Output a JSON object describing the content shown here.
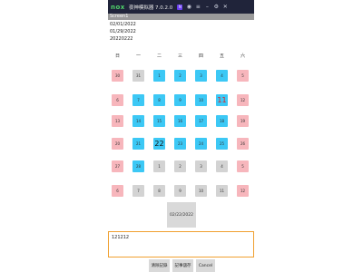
{
  "window": {
    "logo": "nox",
    "title": "夜神模拟器 7.0.2.0",
    "toolbar_icons": [
      "app-icon",
      "user-icon",
      "menu-icon",
      "minimize-icon",
      "settings-icon",
      "close-icon"
    ]
  },
  "screen": {
    "name": "Screen1"
  },
  "dates": [
    "02/01/2022",
    "01/29/2022",
    "20220222"
  ],
  "weekdays": [
    "日",
    "一",
    "二",
    "三",
    "四",
    "五",
    "六"
  ],
  "calendar": [
    [
      {
        "d": "30",
        "c": "pink"
      },
      {
        "d": "31",
        "c": "gray"
      },
      {
        "d": "1",
        "c": "blue"
      },
      {
        "d": "2",
        "c": "blue"
      },
      {
        "d": "3",
        "c": "blue"
      },
      {
        "d": "4",
        "c": "blue"
      },
      {
        "d": "5",
        "c": "pink"
      }
    ],
    [
      {
        "d": "6",
        "c": "pink"
      },
      {
        "d": "7",
        "c": "blue"
      },
      {
        "d": "8",
        "c": "blue"
      },
      {
        "d": "9",
        "c": "blue"
      },
      {
        "d": "10",
        "c": "blue"
      },
      {
        "d": "11",
        "c": "blue",
        "s": "red"
      },
      {
        "d": "12",
        "c": "pink"
      }
    ],
    [
      {
        "d": "13",
        "c": "pink"
      },
      {
        "d": "14",
        "c": "blue"
      },
      {
        "d": "15",
        "c": "blue"
      },
      {
        "d": "16",
        "c": "blue"
      },
      {
        "d": "17",
        "c": "blue"
      },
      {
        "d": "18",
        "c": "blue"
      },
      {
        "d": "19",
        "c": "pink"
      }
    ],
    [
      {
        "d": "20",
        "c": "pink"
      },
      {
        "d": "21",
        "c": "blue"
      },
      {
        "d": "22",
        "c": "blue",
        "s": "big"
      },
      {
        "d": "23",
        "c": "blue"
      },
      {
        "d": "24",
        "c": "blue"
      },
      {
        "d": "25",
        "c": "blue"
      },
      {
        "d": "26",
        "c": "pink"
      }
    ],
    [
      {
        "d": "27",
        "c": "pink"
      },
      {
        "d": "28",
        "c": "blue"
      },
      {
        "d": "1",
        "c": "gray"
      },
      {
        "d": "2",
        "c": "gray"
      },
      {
        "d": "3",
        "c": "gray"
      },
      {
        "d": "4",
        "c": "gray"
      },
      {
        "d": "5",
        "c": "pink"
      }
    ],
    [
      {
        "d": "6",
        "c": "pink"
      },
      {
        "d": "7",
        "c": "gray"
      },
      {
        "d": "8",
        "c": "gray"
      },
      {
        "d": "9",
        "c": "gray"
      },
      {
        "d": "10",
        "c": "gray"
      },
      {
        "d": "11",
        "c": "gray"
      },
      {
        "d": "12",
        "c": "pink"
      }
    ]
  ],
  "colors": {
    "pink": "#f7b6bc",
    "blue": "#3cc8f5",
    "gray": "#d3d3d3",
    "note_border": "#f0a030"
  },
  "date_button": {
    "label": "02/22/2022"
  },
  "note": {
    "value": "121212"
  },
  "buttons": {
    "clear": "清除記錄",
    "save": "記事儲存",
    "cancel": "Cancel"
  }
}
